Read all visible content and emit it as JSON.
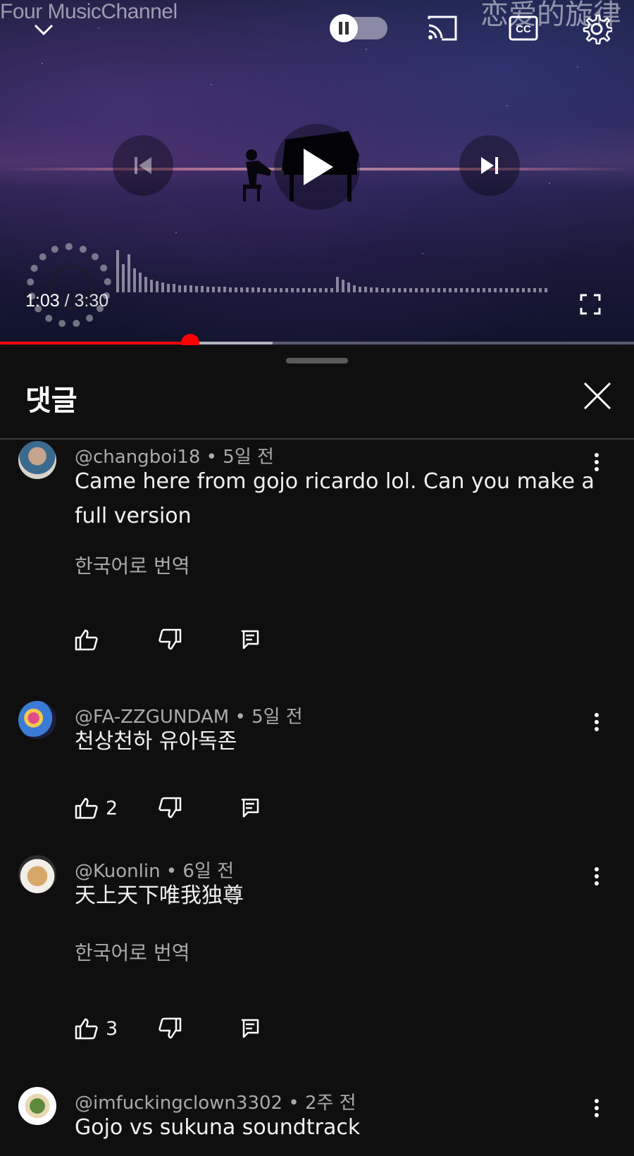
{
  "player": {
    "watermark": "Four MusicChannel",
    "watermark_cn": "恋爱的旋律",
    "current_time": "1:03",
    "duration": "3:30",
    "time_separator": " / ",
    "progress_fraction": 0.3,
    "buffer_fraction": 0.43,
    "icons": {
      "collapse": "chevron-down-icon",
      "autoplay": "autoplay-toggle-icon",
      "cast": "cast-icon",
      "captions": "captions-icon",
      "settings": "gear-icon",
      "previous": "skip-previous-icon",
      "play": "play-icon",
      "next": "skip-next-icon",
      "fullscreen": "fullscreen-icon"
    },
    "accent_color": "#ff0000"
  },
  "comments_panel": {
    "title": "댓글",
    "close_icon": "close-icon",
    "comments": [
      {
        "handle": "@changboi18",
        "age": "5일 전",
        "text": "Came here from gojo ricardo lol. Can you make a full version",
        "translate_label": "한국어로 번역",
        "likes": ""
      },
      {
        "handle": "@FA-ZZGUNDAM",
        "age": "5일 전",
        "text": "천상천하 유아독존",
        "translate_label": "",
        "likes": "2"
      },
      {
        "handle": "@Kuonlin",
        "age": "6일 전",
        "text": "天上天下唯我独尊",
        "translate_label": "한국어로 번역",
        "likes": "3"
      },
      {
        "handle": "@imfuckingclown3302",
        "age": "2주 전",
        "text": "Gojo vs sukuna soundtrack",
        "translate_label": "",
        "likes": ""
      }
    ]
  }
}
